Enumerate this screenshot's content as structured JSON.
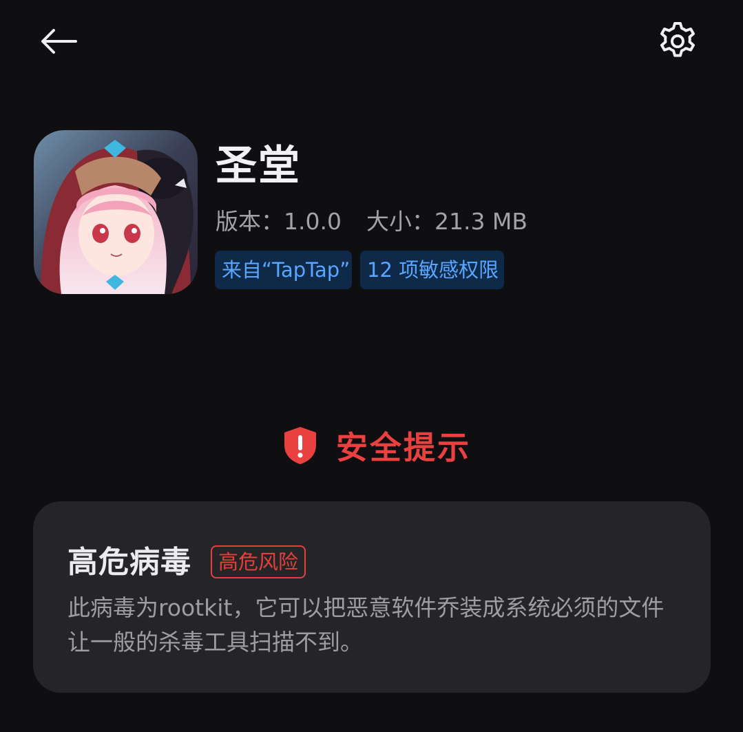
{
  "header": {
    "back_icon": "arrow-left-icon",
    "settings_icon": "gear-icon"
  },
  "app": {
    "name": "圣堂",
    "version_label": "版本：",
    "version": "1.0.0",
    "size_label": "大小：",
    "size": "21.3 MB",
    "source_chip": "来自“TapTap”",
    "permissions_chip": "12 项敏感权限"
  },
  "warning": {
    "icon": "shield-alert-icon",
    "title": "安全提示",
    "color": "#e8413f"
  },
  "threat": {
    "name": "高危病毒",
    "risk_badge": "高危风险",
    "description": "此病毒为rootkit，它可以把恶意软件乔装成系统必须的文件让一般的杀毒工具扫描不到。"
  },
  "colors": {
    "background": "#0f0f11",
    "card": "#252528",
    "chip_bg": "#0e2a48",
    "chip_text": "#5aa6ff",
    "danger": "#e5403e"
  }
}
